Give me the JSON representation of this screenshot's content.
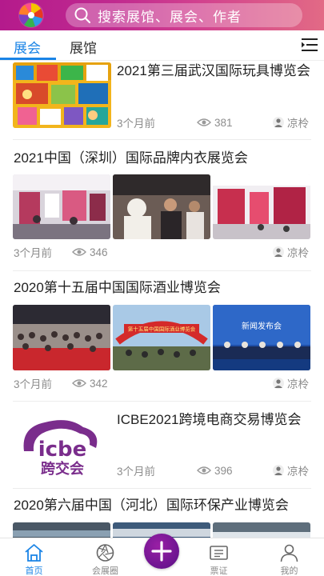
{
  "header": {
    "logo_icon": "pinwheel-logo-icon",
    "search_placeholder": "搜索展馆、展会、作者",
    "colors": {
      "gradient_start": "#b41a8c",
      "gradient_end": "#e26a85"
    }
  },
  "tabs": [
    {
      "label": "展会",
      "active": true
    },
    {
      "label": "展馆",
      "active": false
    }
  ],
  "accent_color": "#1a84e6",
  "feed": [
    {
      "title": "2021第三届武汉国际玩具博览会",
      "time": "3个月前",
      "views": "381",
      "author": "凉柃",
      "layout": "single-image"
    },
    {
      "title": "2021中国（深圳）国际品牌内衣展览会",
      "time": "3个月前",
      "views": "346",
      "author": "凉柃",
      "layout": "three-images"
    },
    {
      "title": "2020第十五届中国国际酒业博览会",
      "time": "3个月前",
      "views": "342",
      "author": "凉柃",
      "layout": "three-images",
      "image_texts": {
        "banner": "第十五届中国国际酒业博览会",
        "screen": "新闻发布会"
      }
    },
    {
      "title": "ICBE2021跨境电商交易博览会",
      "time": "3个月前",
      "views": "396",
      "author": "凉柃",
      "layout": "single-image",
      "logo_text": {
        "latin": "icbe",
        "chinese": "跨交会"
      }
    },
    {
      "title": "2020第六届中国（河北）国际环保产业博览会",
      "layout": "three-images"
    }
  ],
  "bottom_nav": [
    {
      "label": "首页",
      "icon": "home-icon",
      "active": true
    },
    {
      "label": "会展圈",
      "icon": "aperture-icon",
      "active": false
    },
    {
      "label": "",
      "icon": "plus-icon",
      "active": false
    },
    {
      "label": "票证",
      "icon": "ticket-icon",
      "active": false
    },
    {
      "label": "我的",
      "icon": "user-icon",
      "active": false
    }
  ]
}
